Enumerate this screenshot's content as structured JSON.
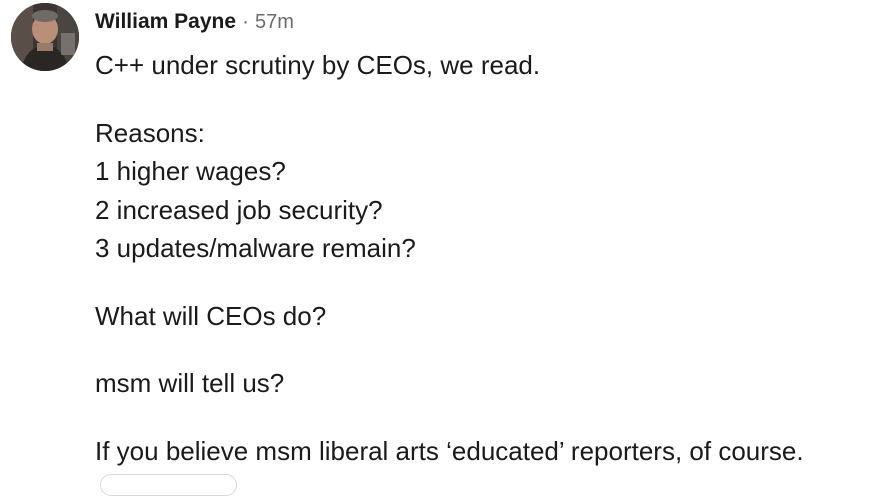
{
  "post": {
    "author": "William Payne",
    "separator": "·",
    "timestamp": "57m",
    "lines": [
      "C++ under scrutiny by CEOs, we read.",
      "Reasons:",
      "1 higher wages?",
      "2 increased job security?",
      "3 updates/malware remain?",
      "What will CEOs do?",
      "msm will tell us?",
      "If you believe msm liberal arts ‘educated’ reporters, of course."
    ]
  },
  "colors": {
    "text": "#1a1a1a",
    "muted": "#6b6b6b",
    "background": "#ffffff"
  }
}
